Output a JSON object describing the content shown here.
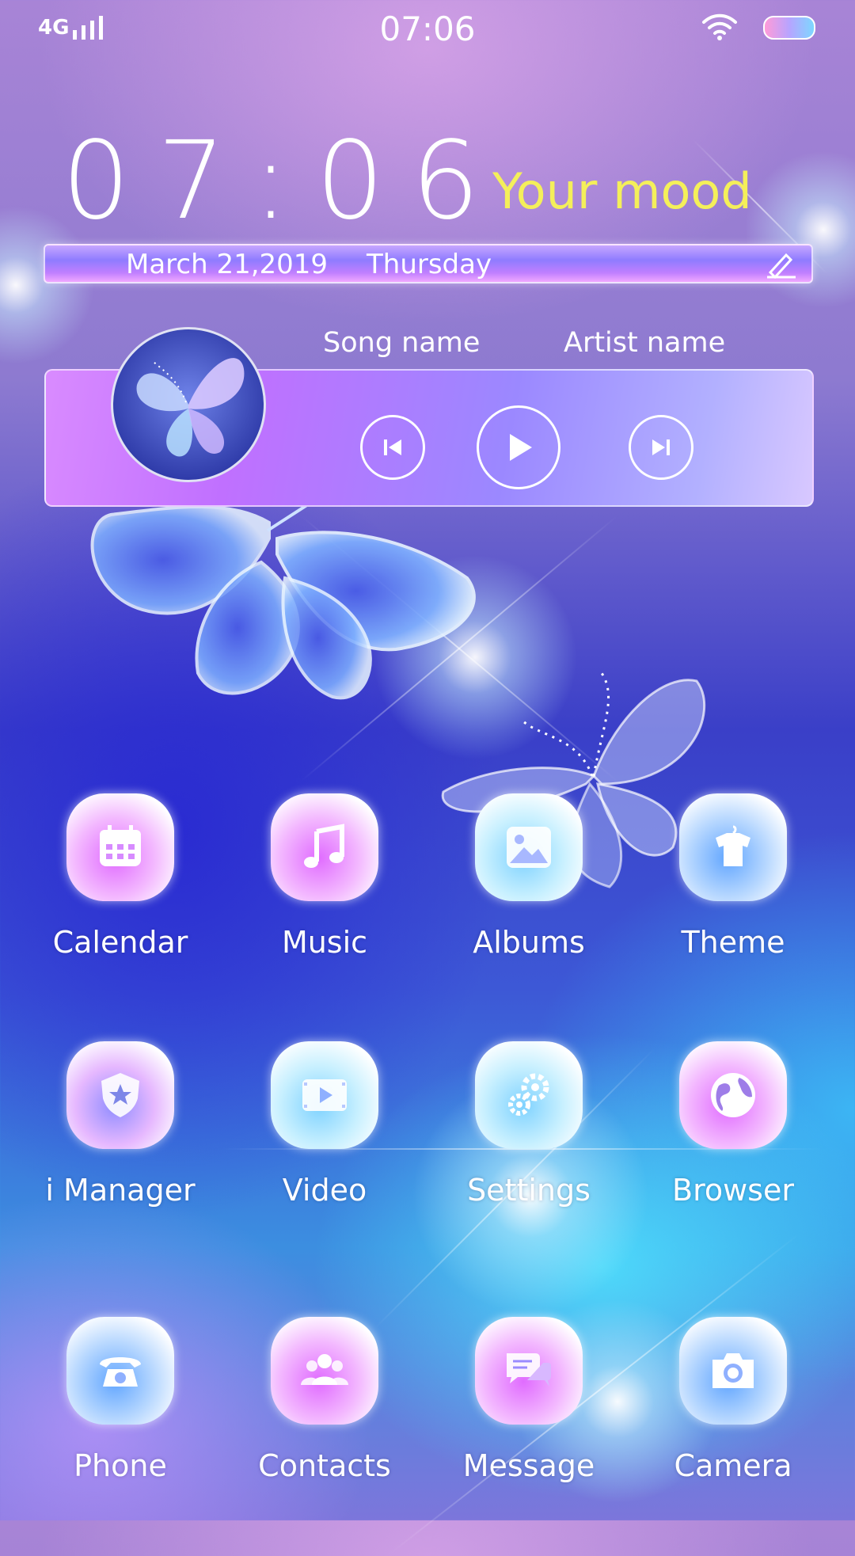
{
  "status_bar": {
    "network": "4G",
    "time": "07:06"
  },
  "clock_widget": {
    "time": "07:06",
    "mood": "Your mood",
    "date": "March 21,2019",
    "day": "Thursday"
  },
  "music_widget": {
    "song": "Song name",
    "artist": "Artist name"
  },
  "apps": [
    {
      "label": "Calendar"
    },
    {
      "label": "Music"
    },
    {
      "label": "Albums"
    },
    {
      "label": "Theme"
    },
    {
      "label": "i Manager"
    },
    {
      "label": "Video"
    },
    {
      "label": "Settings"
    },
    {
      "label": "Browser"
    },
    {
      "label": "Phone"
    },
    {
      "label": "Contacts"
    },
    {
      "label": "Message"
    },
    {
      "label": "Camera"
    }
  ],
  "colors": {
    "mood_text": "#f4ef5a",
    "accent_pink": "#e06cff",
    "accent_blue": "#62a6ff"
  }
}
